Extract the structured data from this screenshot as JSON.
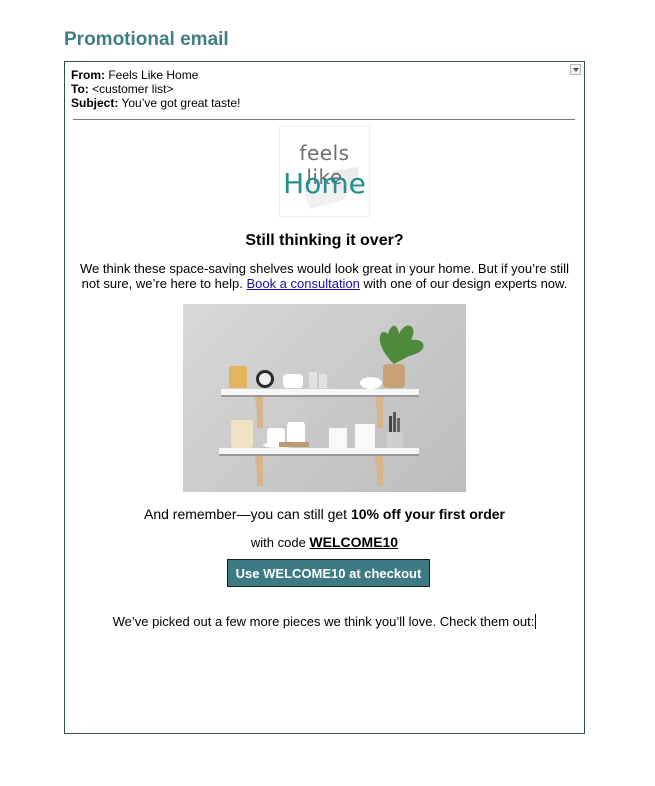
{
  "page": {
    "title": "Promotional email"
  },
  "email": {
    "from_label": "From:",
    "from": "Feels Like Home",
    "to_label": "To:",
    "to": "<customer list>",
    "subject_label": "Subject:",
    "subject": "You’ve got great taste!"
  },
  "logo": {
    "line1": "feels like",
    "line2": "Home",
    "brand_color": "#23908f"
  },
  "body": {
    "headline": "Still thinking it over?",
    "intro_before": "We think these space-saving shelves would look great in your home. But if you’re still not sure, we’re here to help.",
    "intro_link": "Book a consultation",
    "intro_after": "with one of our design experts now.",
    "remember_prefix": "And remember—you can still get",
    "remember_bold": "10% off your first order",
    "code_prefix": "with code",
    "code": "WELCOME10",
    "cta_label": "Use WELCOME10 at checkout",
    "cta_color": "#3d7a84",
    "more_text": "We’ve picked out a few more pieces we think you’ll love. Check them out:"
  }
}
